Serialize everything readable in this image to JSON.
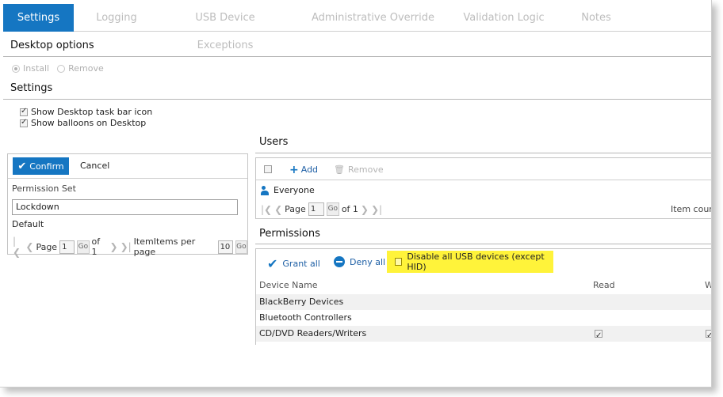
{
  "tabs": [
    {
      "label": "Settings",
      "active": true
    },
    {
      "label": "Logging",
      "active": false
    },
    {
      "label": "USB Device Exceptions",
      "active": false
    },
    {
      "label": "Administrative Override",
      "active": false
    },
    {
      "label": "Validation Logic",
      "active": false
    },
    {
      "label": "Notes",
      "active": false
    }
  ],
  "desktop_options": {
    "title": "Desktop options",
    "install_label": "Install",
    "remove_label": "Remove",
    "selected": "Install"
  },
  "settings": {
    "title": "Settings",
    "options": [
      {
        "label": "Show Desktop task bar icon",
        "checked": true
      },
      {
        "label": "Show balloons on Desktop",
        "checked": true
      }
    ]
  },
  "permission_set_panel": {
    "confirm_label": "Confirm",
    "cancel_label": "Cancel",
    "field_label": "Permission Set",
    "field_value": "Lockdown",
    "default_label": "Default",
    "pager": {
      "page_label": "Page",
      "page_value": "1",
      "go_label": "Go",
      "of_label": "of 1",
      "items_label": "ItemItems per page",
      "per_page_value": "10",
      "go2_label": "Go"
    }
  },
  "users": {
    "title": "Users",
    "add_label": "Add",
    "remove_label": "Remove",
    "rows": [
      "Everyone"
    ],
    "pager": {
      "page_label": "Page",
      "page_value": "1",
      "go_label": "Go",
      "of_label": "of 1",
      "item_count_label": "Item count"
    }
  },
  "permissions": {
    "title": "Permissions",
    "grant_label": "Grant all",
    "deny_label": "Deny all",
    "usb_toggle_label": "Disable all USB devices (except HID)",
    "usb_toggle_checked": false,
    "columns": [
      "Device Name",
      "Read",
      "W"
    ],
    "rows": [
      {
        "name": "BlackBerry Devices",
        "read": null,
        "write": null
      },
      {
        "name": "Bluetooth Controllers",
        "read": null,
        "write": null
      },
      {
        "name": "CD/DVD Readers/Writers",
        "read": true,
        "write": true
      }
    ]
  },
  "colors": {
    "accent": "#1576c2",
    "highlight": "#fff33a"
  }
}
